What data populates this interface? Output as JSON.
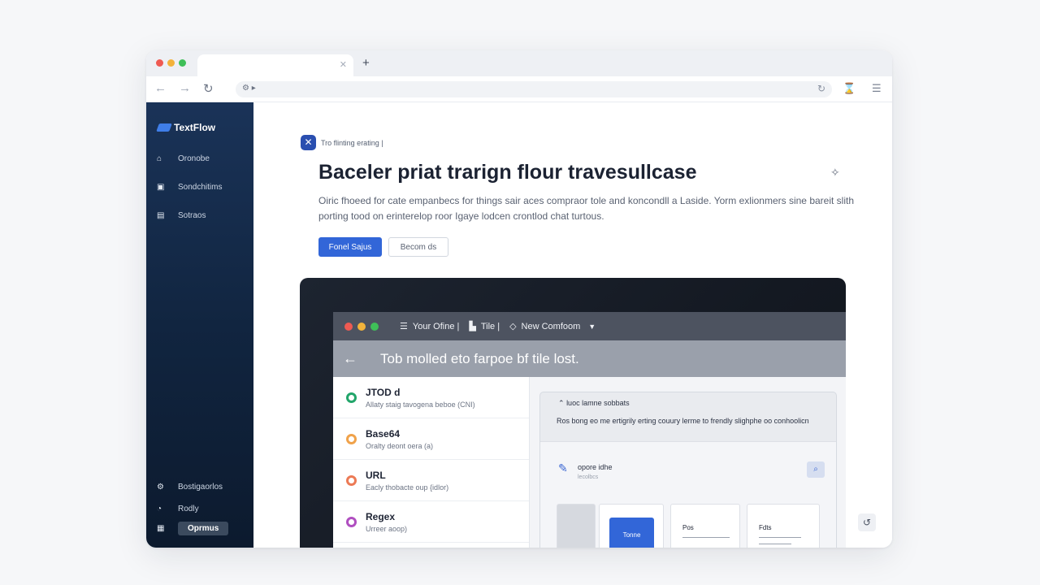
{
  "browser": {
    "dots": [
      "#ef5a52",
      "#f3b23a",
      "#3fbf58"
    ],
    "tab_close": "✕",
    "new_tab": "+",
    "back": "←",
    "forward": "→",
    "reload": "↻",
    "address_icon": "⚙ ▸",
    "address_reload": "↻",
    "ext_icon": "⌛",
    "menu_icon": "☰"
  },
  "sidebar": {
    "brand": "TextFlow",
    "brand_color": "#3f7ee8",
    "items": [
      {
        "icon": "⌂",
        "label": "Oronobe"
      },
      {
        "icon": "▣",
        "label": "Sondchitims"
      },
      {
        "icon": "▤",
        "label": "Sotraos"
      }
    ],
    "footer": [
      {
        "icon": "⚙",
        "label": "Bostigaorlos"
      },
      {
        "icon": "◔",
        "label": "Rodly"
      },
      {
        "icon": "▦",
        "label": "Oprmus"
      }
    ]
  },
  "hero": {
    "chip_icon": "✕",
    "chip_text": "Tro flinting erating |",
    "headline": "Baceler priat trarign flour travesullcase",
    "sparkle": "✧",
    "lede": "Oiric fhoeed for cate empanbecs for things sair aces compraor tole and koncondll a Laside. Yorm exlionmers sine bareit slith porting tood on erinterelop roor Igaye lodcen crontlod chat turtous.",
    "primary_button": "Fonel Sajus",
    "secondary_button": "Becom ds"
  },
  "app": {
    "dots": [
      "#ee5a52",
      "#f2b33b",
      "#3fbf58"
    ],
    "title_parts": [
      {
        "icon": "☰",
        "text": "Your Ofine |"
      },
      {
        "icon": "▙",
        "text": "Tile |"
      },
      {
        "icon": "◇",
        "text": "New Comfoom"
      }
    ],
    "title_caret": "▼",
    "banner_back": "←",
    "banner_text": "Tob molled eto farpoe bf tile lost.",
    "tools": [
      {
        "name": "JTOD d",
        "desc": "Allaty staig tavogena beboe (CNI)",
        "color": "#22a56a"
      },
      {
        "name": "Base64",
        "desc": "Oralty deont oera (a)",
        "color": "#f0a24a"
      },
      {
        "name": "URL",
        "desc": "Eacly thobacte oup {idlor)",
        "color": "#ec7a55"
      },
      {
        "name": "Regex",
        "desc": "Urreer aoop)",
        "color": "#b04fc0"
      }
    ],
    "detail": {
      "head_icon": "⌃",
      "head": "luoc lamne sobbats",
      "body": "Ros bong eo me ertigrily erting couury lerme to frendly slighphe oo conhoolicn",
      "edit_icon": "✎",
      "label": "opore idhe",
      "sub": "lecolbcs",
      "search_icon": "⌕",
      "card_blue": "Tonne",
      "card_pos": "Pos",
      "card_fds": "Fdts"
    }
  },
  "fab_icon": "↺"
}
